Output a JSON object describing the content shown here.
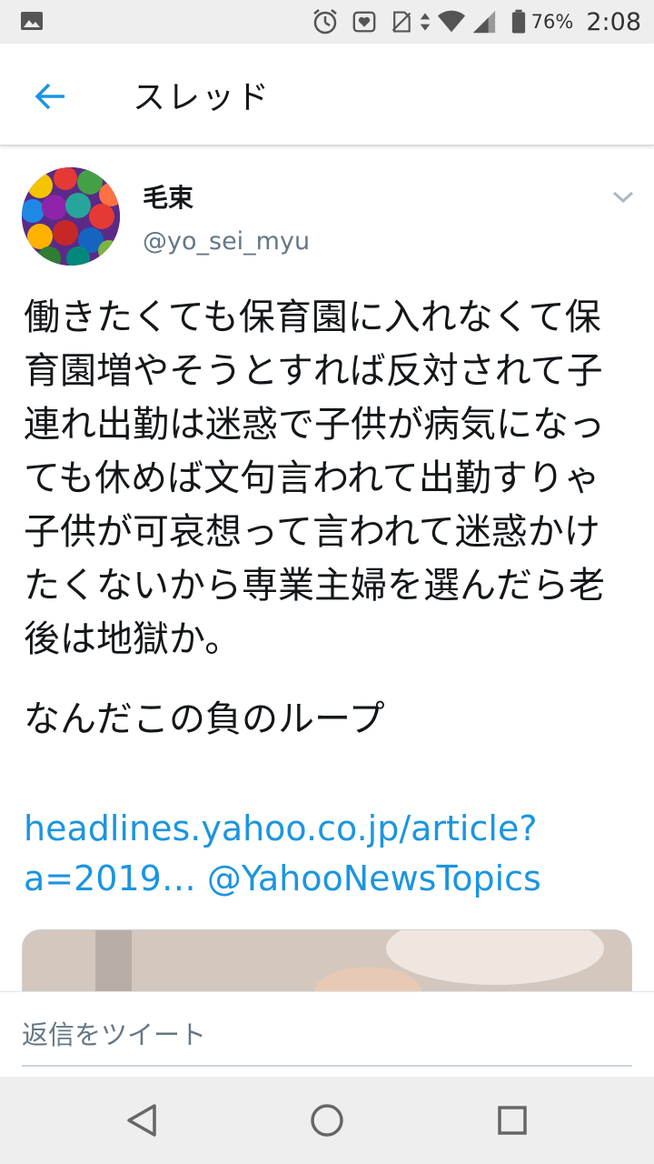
{
  "status_bar": {
    "battery_percent": "76%",
    "time": "2:08",
    "icons": [
      "gallery-icon",
      "alarm-icon",
      "heart-badge-icon",
      "no-sim-icon",
      "data-arrows-icon",
      "wifi-icon",
      "signal-icon",
      "battery-icon"
    ]
  },
  "app_bar": {
    "title": "スレッド"
  },
  "tweet": {
    "author_name": "毛束",
    "author_handle": "@yo_sei_myu",
    "text": "働きたくても保育園に入れなくて保育園増やそうとすれば反対されて子連れ出勤は迷惑で子供が病気になっても休めば文句言われて出勤すりゃ子供が可哀想って言われて迷惑かけたくないから専業主婦を選んだら老後は地獄か。",
    "text2": "なんだこの負のループ",
    "link_line1": "headlines.yahoo.co.jp/article?",
    "link_line2": "a=2019… @YahooNewsTopics"
  },
  "reply": {
    "placeholder": "返信をツイート"
  },
  "colors": {
    "link": "#1b95e0",
    "text": "#14171a",
    "secondary": "#657786"
  }
}
